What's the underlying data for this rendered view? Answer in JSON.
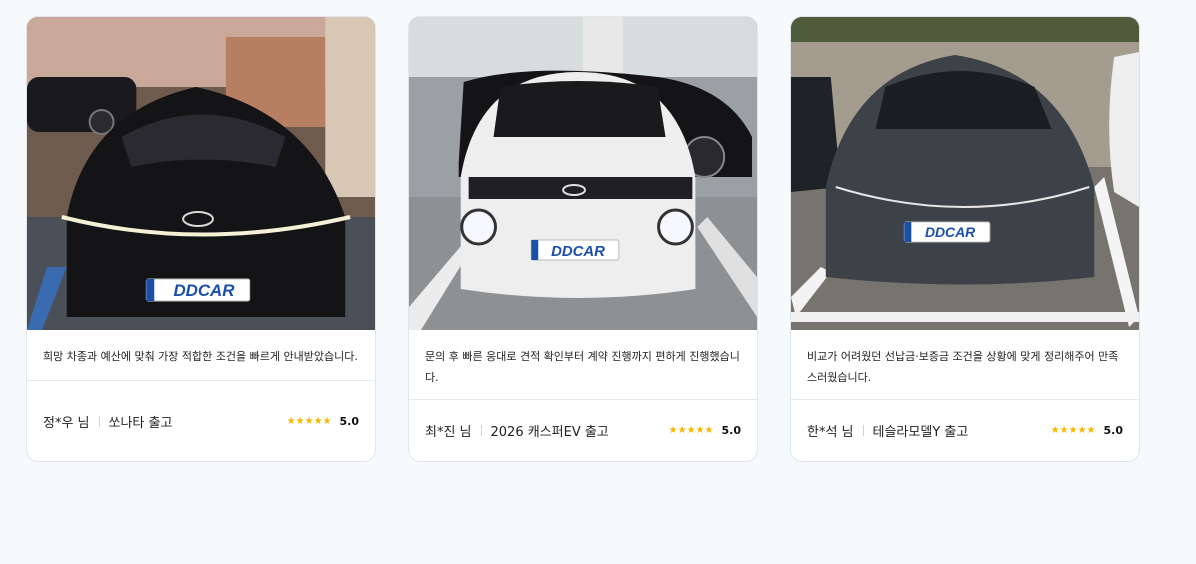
{
  "reviews": [
    {
      "text": "희망 차종과 예산에 맞춰 가장 적합한 조건을 빠르게 안내받았습니다.",
      "author": "정*우 님",
      "model": "쏘나타 출고",
      "stars": "★★★★★",
      "rating": "5.0",
      "plate": "DDCAR",
      "car_color": "#1b1b1f"
    },
    {
      "text": "문의 후 빠른 응대로 견적 확인부터 계약 진행까지 편하게 진행했습니다.",
      "author": "최*진 님",
      "model": "2026 캐스퍼EV 출고",
      "stars": "★★★★★",
      "rating": "5.0",
      "plate": "DDCAR",
      "car_color": "#f2f2f2"
    },
    {
      "text": "비교가 어려웠던 선납금·보증금 조건을 상황에 맞게 정리해주어 만족스러웠습니다.",
      "author": "한*석 님",
      "model": "테슬라모델Y 출고",
      "stars": "★★★★★",
      "rating": "5.0",
      "plate": "DDCAR",
      "car_color": "#3b3f45"
    }
  ],
  "colors": {
    "star": "#f5b800",
    "plate_text": "#1b4fa8",
    "page_bg": "#f7fafd"
  }
}
